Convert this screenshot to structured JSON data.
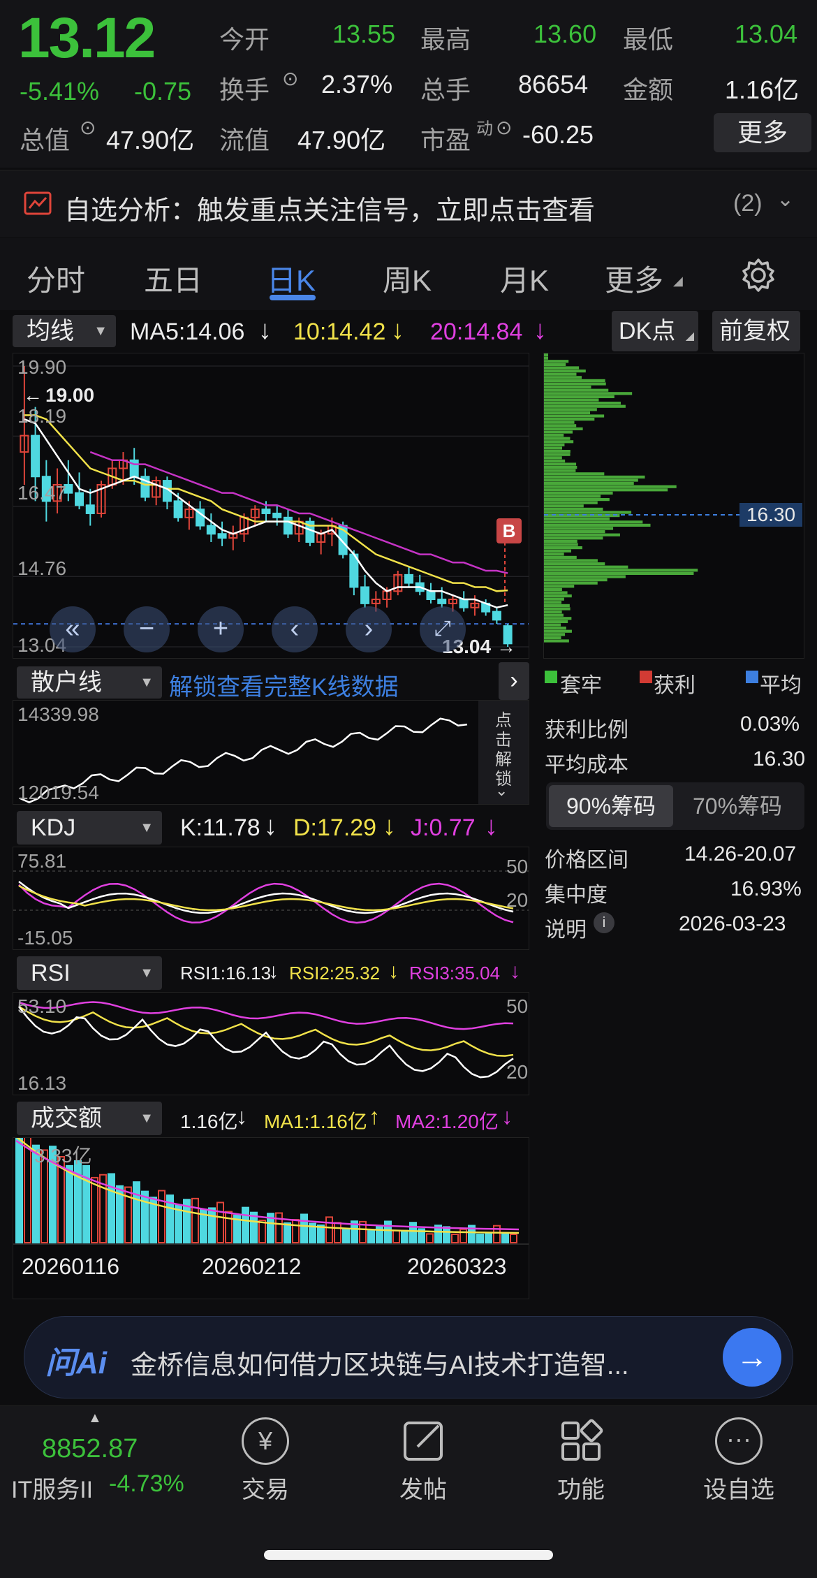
{
  "quote": {
    "price": "13.12",
    "change_pct": "-5.41%",
    "change": "-0.75",
    "open_label": "今开",
    "open": "13.55",
    "high_label": "最高",
    "high": "13.60",
    "low_label": "最低",
    "low": "13.04",
    "turnover_label": "换手",
    "turnover": "2.37%",
    "volume_label": "总手",
    "volume": "86654",
    "amount_label": "金额",
    "amount": "1.16亿",
    "mktcap_label": "总值",
    "mktcap": "47.90亿",
    "float_label": "流值",
    "float_cap": "47.90亿",
    "pe_label": "市盈",
    "pe_sup": "动",
    "pe": "-60.25",
    "more_label": "更多"
  },
  "alert": {
    "text": "自选分析：触发重点关注信号，立即点击查看",
    "count": "(2)"
  },
  "tabs": [
    "分时",
    "五日",
    "日K",
    "周K",
    "月K",
    "更多"
  ],
  "ma_bar": {
    "selector": "均线",
    "ma5": "MA5:14.06",
    "ma10": "10:14.42",
    "ma20": "20:14.84",
    "dk": "DK点",
    "adj": "前复权"
  },
  "kline": {
    "labels": {
      "top": "19.90",
      "l2": "18.19",
      "l3": "16.47",
      "l4": "14.76",
      "bottom": "13.04",
      "max_mark": "19.00",
      "min_mark": "13.04",
      "b_mark": "B"
    },
    "ohlc": [
      [
        17.8,
        19.9,
        17.0,
        18.2
      ],
      [
        18.2,
        18.9,
        16.6,
        17.2
      ],
      [
        17.2,
        17.6,
        16.1,
        16.6
      ],
      [
        16.6,
        17.4,
        16.3,
        17.0
      ],
      [
        17.0,
        17.6,
        16.6,
        16.8
      ],
      [
        16.8,
        17.3,
        16.4,
        16.5
      ],
      [
        16.5,
        16.9,
        16.0,
        16.3
      ],
      [
        16.3,
        17.1,
        16.2,
        17.0
      ],
      [
        17.0,
        17.6,
        16.9,
        17.4
      ],
      [
        17.4,
        17.8,
        17.0,
        17.6
      ],
      [
        17.6,
        17.9,
        17.0,
        17.2
      ],
      [
        17.2,
        17.4,
        16.6,
        16.7
      ],
      [
        16.7,
        17.2,
        16.5,
        17.1
      ],
      [
        17.1,
        17.2,
        16.4,
        16.6
      ],
      [
        16.6,
        16.8,
        16.1,
        16.2
      ],
      [
        16.2,
        16.6,
        15.9,
        16.4
      ],
      [
        16.4,
        16.6,
        15.9,
        16.0
      ],
      [
        16.0,
        16.3,
        15.6,
        15.8
      ],
      [
        15.8,
        16.1,
        15.5,
        15.7
      ],
      [
        15.7,
        16.0,
        15.4,
        15.8
      ],
      [
        15.8,
        16.3,
        15.6,
        16.2
      ],
      [
        16.2,
        16.5,
        16.0,
        16.4
      ],
      [
        16.4,
        16.6,
        16.1,
        16.3
      ],
      [
        16.3,
        16.5,
        16.0,
        16.2
      ],
      [
        16.2,
        16.4,
        15.7,
        15.8
      ],
      [
        15.8,
        16.2,
        15.6,
        16.1
      ],
      [
        16.1,
        16.2,
        15.5,
        15.6
      ],
      [
        15.6,
        15.9,
        15.3,
        15.8
      ],
      [
        15.8,
        16.2,
        15.5,
        16.0
      ],
      [
        16.0,
        16.1,
        15.2,
        15.3
      ],
      [
        15.3,
        15.4,
        14.3,
        14.5
      ],
      [
        14.5,
        14.8,
        14.0,
        14.1
      ],
      [
        14.1,
        14.4,
        13.9,
        14.2
      ],
      [
        14.2,
        14.5,
        14.0,
        14.4
      ],
      [
        14.4,
        14.9,
        14.3,
        14.8
      ],
      [
        14.8,
        15.0,
        14.5,
        14.6
      ],
      [
        14.6,
        14.8,
        14.3,
        14.4
      ],
      [
        14.4,
        14.6,
        14.1,
        14.2
      ],
      [
        14.2,
        14.5,
        14.0,
        14.1
      ],
      [
        14.1,
        14.3,
        13.9,
        14.2
      ],
      [
        14.2,
        14.4,
        13.9,
        14.0
      ],
      [
        14.0,
        14.3,
        13.8,
        14.1
      ],
      [
        14.1,
        14.2,
        13.8,
        13.9
      ],
      [
        13.9,
        14.0,
        13.6,
        13.7
      ],
      [
        13.55,
        13.6,
        13.04,
        13.12
      ]
    ],
    "ma5": [
      18.6,
      18.5,
      18.1,
      17.7,
      17.3,
      16.9,
      16.8,
      16.9,
      17.0,
      17.1,
      17.2,
      17.1,
      17.0,
      16.9,
      16.7,
      16.5,
      16.3,
      16.1,
      15.9,
      15.8,
      15.9,
      16.0,
      16.1,
      16.1,
      16.1,
      16.0,
      15.9,
      15.8,
      15.9,
      15.6,
      15.3,
      14.9,
      14.6,
      14.4,
      14.5,
      14.5,
      14.5,
      14.4,
      14.4,
      14.3,
      14.2,
      14.2,
      14.1,
      14.0,
      14.06
    ],
    "ma10": [
      18.7,
      18.7,
      18.6,
      18.3,
      18.0,
      17.7,
      17.4,
      17.3,
      17.2,
      17.1,
      17.1,
      17.0,
      17.0,
      16.9,
      16.9,
      16.8,
      16.7,
      16.6,
      16.4,
      16.3,
      16.2,
      16.1,
      16.1,
      16.1,
      16.1,
      16.1,
      16.0,
      16.0,
      16.0,
      15.9,
      15.7,
      15.5,
      15.3,
      15.2,
      15.1,
      15.0,
      14.9,
      14.8,
      14.7,
      14.6,
      14.6,
      14.5,
      14.5,
      14.4,
      14.42
    ],
    "ma20": [
      null,
      null,
      null,
      null,
      null,
      null,
      17.8,
      17.7,
      17.6,
      17.6,
      17.5,
      17.5,
      17.4,
      17.3,
      17.2,
      17.1,
      17.0,
      16.9,
      16.8,
      16.8,
      16.7,
      16.6,
      16.5,
      16.5,
      16.4,
      16.3,
      16.3,
      16.2,
      16.1,
      16.0,
      15.9,
      15.8,
      15.7,
      15.6,
      15.5,
      15.4,
      15.3,
      15.3,
      15.2,
      15.1,
      15.1,
      15.0,
      14.9,
      14.9,
      14.84
    ]
  },
  "chips": {
    "price_tag": "16.30",
    "legend": [
      "套牢",
      "获利",
      "平均"
    ],
    "rows": [
      {
        "k": "获利比例",
        "v": "0.03%"
      },
      {
        "k": "平均成本",
        "v": "16.30"
      }
    ],
    "tabs": [
      "90%筹码",
      "70%筹码"
    ],
    "rows2": [
      {
        "k": "价格区间",
        "v": "14.26-20.07"
      },
      {
        "k": "集中度",
        "v": "16.93%"
      },
      {
        "k": "说明",
        "v": "2026-03-23"
      }
    ]
  },
  "retail": {
    "selector": "散户线",
    "unlock": "解锁查看完整K线数据",
    "top": "14339.98",
    "bottom": "12019.54",
    "side": [
      "点",
      "击",
      "解",
      "锁"
    ]
  },
  "kdj": {
    "selector": "KDJ",
    "k": "K:11.78",
    "d": "D:17.29",
    "j": "J:0.77",
    "top": "75.81",
    "bottom": "-15.05",
    "l50": "50",
    "l20": "20"
  },
  "rsi": {
    "selector": "RSI",
    "r1": "RSI1:16.13",
    "r2": "RSI2:25.32",
    "r3": "RSI3:35.04",
    "top": "53.10",
    "bottom": "16.13",
    "l50": "50",
    "l20": "20"
  },
  "vol": {
    "selector": "成交额",
    "cur": "1.16亿",
    "ma1": "MA1:1.16亿",
    "ma2": "MA2:1.20亿",
    "top": "3.33亿",
    "dates": [
      "20260116",
      "20260212",
      "20260323"
    ]
  },
  "ai": {
    "brand": "问Ai",
    "text": "金桥信息如何借力区块链与AI技术打造智..."
  },
  "nav": {
    "index_value": "8852.87",
    "index_name": "IT服务II",
    "index_change": "-4.73%",
    "items": [
      "交易",
      "发帖",
      "功能",
      "设自选"
    ]
  }
}
